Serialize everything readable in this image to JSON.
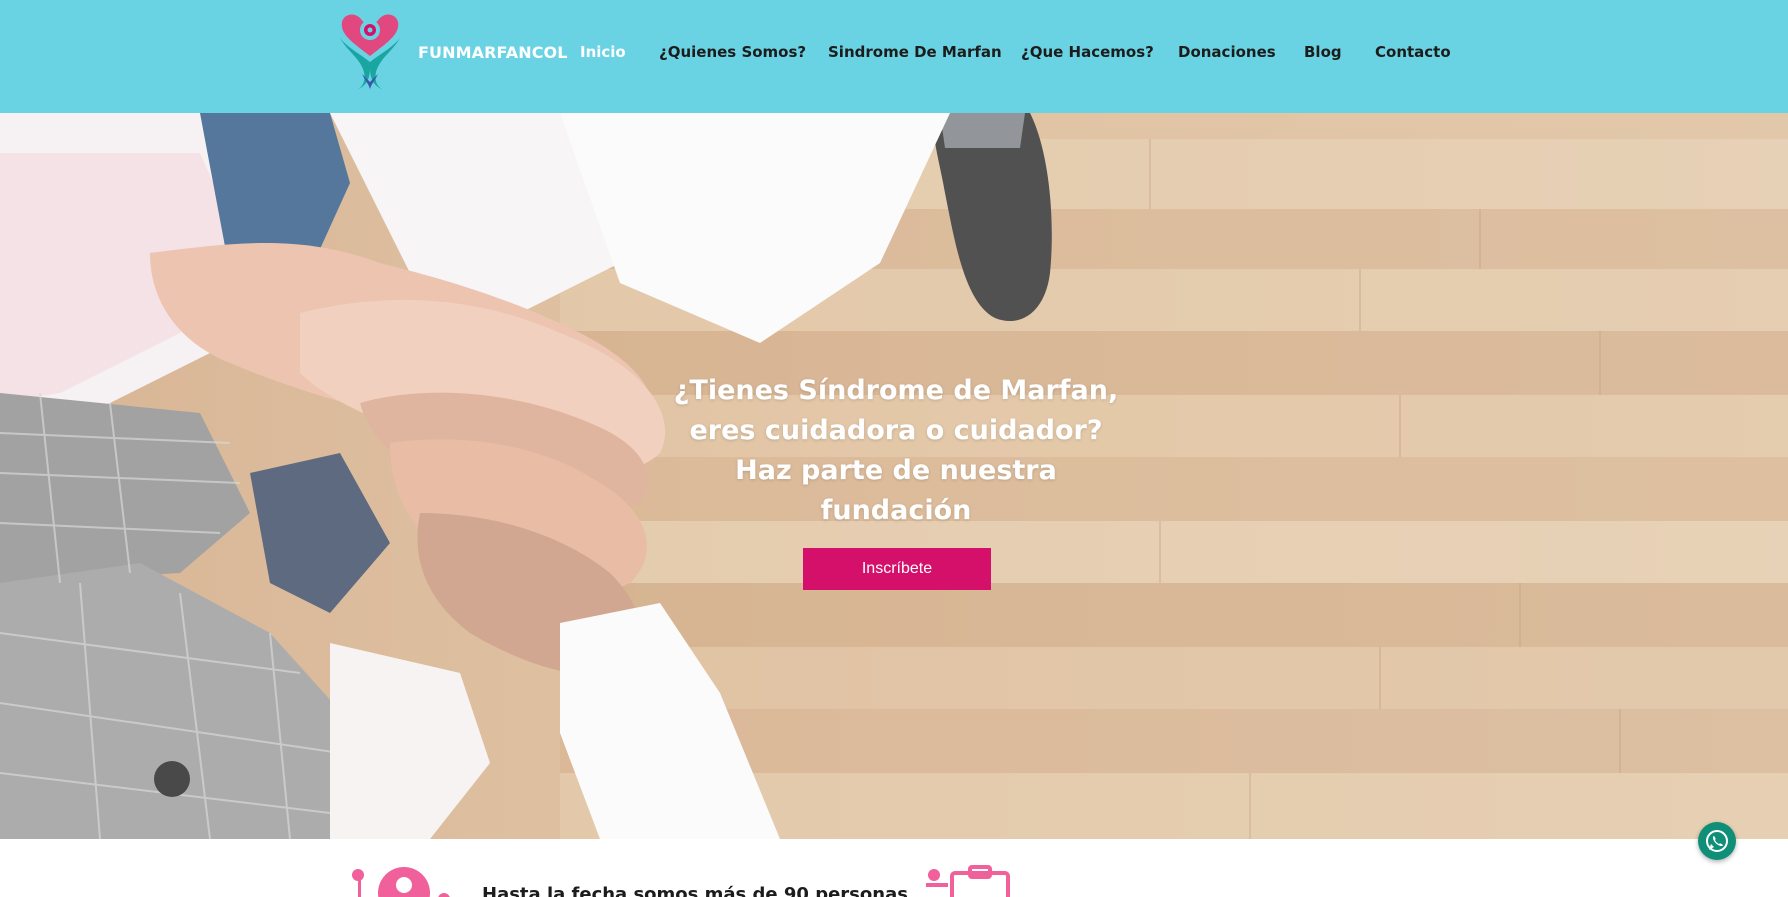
{
  "header": {
    "brand": "FUNMARFANCOL",
    "nav": [
      {
        "label": "Inicio",
        "active": true
      },
      {
        "label": "¿Quienes Somos?"
      },
      {
        "label": "Sindrome De Marfan"
      },
      {
        "label": "¿Que Hacemos?"
      },
      {
        "label": "Donaciones"
      },
      {
        "label": "Blog"
      },
      {
        "label": "Contacto"
      }
    ]
  },
  "hero": {
    "title_lines": [
      "¿Tienes Síndrome de Marfan,",
      "eres cuidadora o cuidador?",
      "Haz parte de nuestra",
      "fundación"
    ],
    "cta_label": "Inscríbete"
  },
  "stats": {
    "text": "Hasta la fecha somos más de 90 personas"
  },
  "floating": {
    "whatsapp_icon": "whatsapp-icon"
  },
  "colors": {
    "header_bg": "#6ad3e3",
    "accent": "#d4106b",
    "brand_text": "#ffffff",
    "whatsapp": "#0f8f77"
  }
}
